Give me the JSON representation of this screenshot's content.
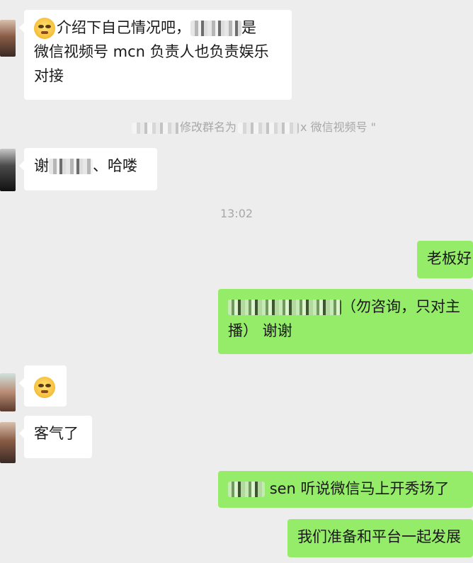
{
  "messages": [
    {
      "side": "incoming",
      "text_1": "介绍下自己情况吧，",
      "text_2": "是",
      "line_2": "微信视频号 mcn 负责人也负责娱乐",
      "line_3": "对接",
      "emoji": "smiling-face-emoji"
    },
    {
      "side": "incoming",
      "text_1": "谢",
      "text_2": "、哈喽"
    },
    {
      "side": "outgoing",
      "text": "老板好"
    },
    {
      "side": "outgoing",
      "text_1": "（勿咨询，只对主",
      "line_2": "播） 谢谢"
    },
    {
      "side": "incoming",
      "emoji": "smiling-face-emoji"
    },
    {
      "side": "incoming",
      "text": "客气了"
    },
    {
      "side": "outgoing",
      "text": "sen 听说微信马上开秀场了"
    },
    {
      "side": "outgoing",
      "text": "我们准备和平台一起发展"
    }
  ],
  "system": {
    "rename_prefix": "修改群名为",
    "rename_suffix": "x 微信视频号 \"",
    "time": "13:02"
  },
  "colors": {
    "background": "#ededed",
    "incoming_bubble": "#ffffff",
    "outgoing_bubble": "#95ec69",
    "system_text": "#a8a8a8"
  }
}
